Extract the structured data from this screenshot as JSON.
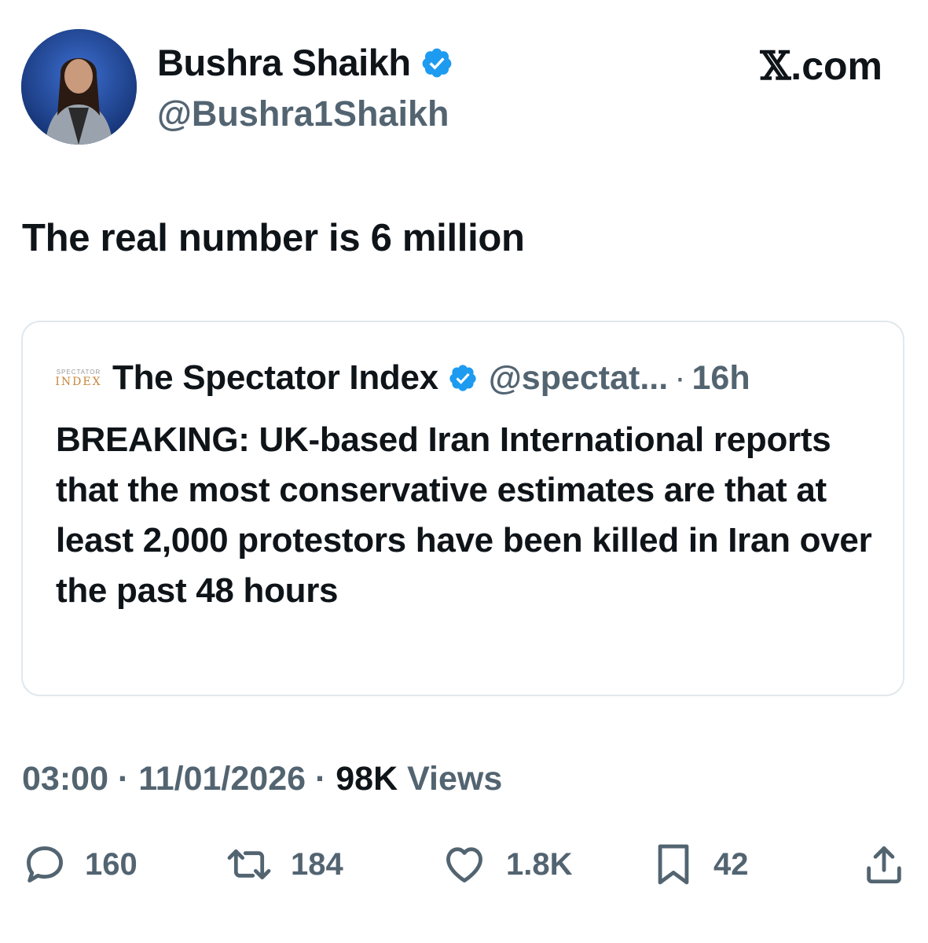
{
  "author": {
    "display_name": "Bushra Shaikh",
    "handle": "@Bushra1Shaikh",
    "verified_icon": "verified-badge-icon"
  },
  "brand": {
    "glyph": "𝕏",
    "suffix": ".com"
  },
  "tweet": {
    "text": "The real number is 6 million"
  },
  "quoted_tweet": {
    "logo_line1": "SPECTATOR",
    "logo_line2": "INDEX",
    "display_name": "The Spectator Index",
    "handle": "@spectat...",
    "separator": "·",
    "time": "16h",
    "text": "BREAKING: UK-based Iran International reports that the most conservative estimates are that at least 2,000 protestors have been killed in Iran over the past 48 hours"
  },
  "meta": {
    "time": "03:00",
    "separator1": " · ",
    "date": "11/01/2026",
    "separator2": " · ",
    "views_count": "98K",
    "views_label": " Views"
  },
  "actions": {
    "replies": "160",
    "reposts": "184",
    "likes": "1.8K",
    "bookmarks": "42"
  },
  "colors": {
    "verified_blue": "#1d9bf0",
    "secondary_text": "#536471",
    "primary_text": "#0f1419",
    "border": "#e1e8ed"
  }
}
